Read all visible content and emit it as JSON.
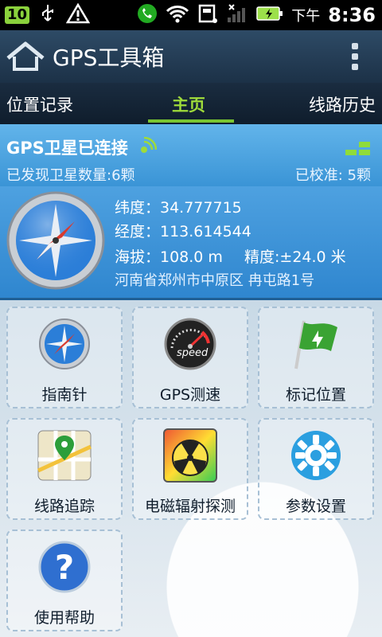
{
  "statusbar": {
    "badge": "10",
    "ampm": "下午",
    "time": "8:36"
  },
  "app": {
    "title": "GPS工具箱"
  },
  "tabs": [
    {
      "label": "位置记录"
    },
    {
      "label": "主页"
    },
    {
      "label": "线路历史"
    }
  ],
  "gps": {
    "status": "GPS卫星已连接",
    "satellites_found": "已发现卫星数量:6颗",
    "calibrated": "已校准: 5颗"
  },
  "location": {
    "latitude": "纬度：34.777715",
    "longitude": "经度：113.614544",
    "altitude": "海拔：108.0 m",
    "accuracy": "精度:±24.0 米",
    "address": "河南省郑州市中原区 冉屯路1号"
  },
  "tiles": [
    {
      "label": "指南针",
      "icon": "compass-icon"
    },
    {
      "label": "GPS测速",
      "icon": "speedometer-icon"
    },
    {
      "label": "标记位置",
      "icon": "flag-icon"
    },
    {
      "label": "线路追踪",
      "icon": "map-pin-icon"
    },
    {
      "label": "电磁辐射探测",
      "icon": "radiation-icon"
    },
    {
      "label": "参数设置",
      "icon": "gear-icon"
    },
    {
      "label": "使用帮助",
      "icon": "help-icon"
    }
  ],
  "speed_icon_text": "speed",
  "colors": {
    "accent_green": "#7ac531",
    "panel_blue": "#3a94d6"
  }
}
